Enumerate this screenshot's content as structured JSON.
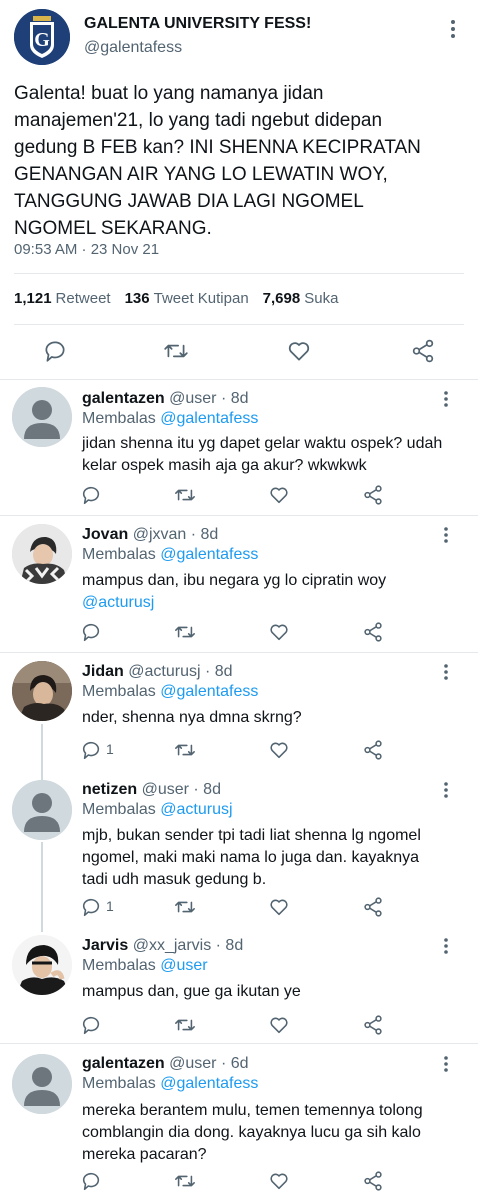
{
  "tweet": {
    "account_name": "GALENTA UNIVERSITY FESS!",
    "handle": "@galentafess",
    "avatar_letter": "G",
    "body": "Galenta! buat lo yang namanya jidan\nmanajemen'21, lo yang tadi ngebut didepan\ngedung B FEB kan? INI SHENNA KECIPRATAN\nGENANGAN AIR YANG LO LEWATIN WOY,\nTANGGUNG JAWAB DIA LAGI NGOMEL\nNGOMEL SEKARANG.",
    "timestamp": "09:53 AM · 23 Nov 21",
    "stats": {
      "retweets_count": "1,121",
      "retweets_label": "Retweet",
      "quotes_count": "136",
      "quotes_label": "Tweet Kutipan",
      "likes_count": "7,698",
      "likes_label": "Suka"
    }
  },
  "replying_label": "Membalas",
  "replies": [
    {
      "name": "galentazen",
      "meta": "@user · 8d",
      "replying_to": "@galentafess",
      "text": "jidan shenna itu yg dapet gelar waktu ospek? udah\nkelar ospek masih aja ga akur? wkwkwk",
      "reply_count": ""
    },
    {
      "name": "Jovan",
      "meta": "@jxvan · 8d",
      "replying_to": "@galentafess",
      "text": "mampus dan, ibu negara yg lo cipratin woy",
      "text_mention": "@acturusj",
      "reply_count": ""
    },
    {
      "name": "Jidan",
      "meta": "@acturusj · 8d",
      "replying_to": "@galentafess",
      "text": "nder, shenna nya dmna skrng?",
      "reply_count": "1"
    },
    {
      "name": "netizen",
      "meta": "@user · 8d",
      "replying_to": "@acturusj",
      "text": "mjb, bukan sender tpi tadi liat shenna lg ngomel\nngomel, maki maki nama lo juga dan. kayaknya\ntadi udh masuk gedung b.",
      "reply_count": "1"
    },
    {
      "name": "Jarvis",
      "meta": "@xx_jarvis · 8d",
      "replying_to": "@user",
      "text": "mampus dan, gue ga ikutan ye",
      "reply_count": ""
    },
    {
      "name": "galentazen",
      "meta": "@user · 6d",
      "replying_to": "@galentafess",
      "text": "mereka berantem mulu, temen temennya tolong\ncomblangin dia dong. kayaknya lucu ga sih kalo\nmereka pacaran?",
      "reply_count": ""
    }
  ],
  "colors": {
    "text": "#0f1419",
    "secondary": "#536471",
    "link": "#1d9bf0",
    "divider": "#e6e9ec",
    "default_avatar_bg": "#cfd9de",
    "default_avatar_fg": "#6e767d",
    "brand_logo_bg": "#1e3f77"
  },
  "icons": {
    "reply": "comment-icon",
    "retweet": "retweet-icon",
    "like": "heart-icon",
    "share": "share-icon",
    "more": "more-vertical-icon"
  }
}
